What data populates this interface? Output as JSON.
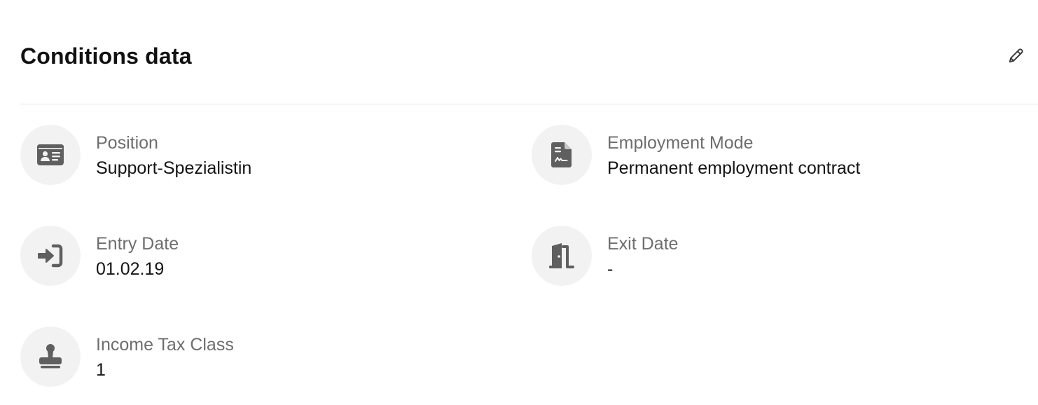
{
  "title": "Conditions data",
  "edit_icon": "pencil-icon",
  "fields": [
    {
      "label": "Position",
      "value": "Support-Spezialistin",
      "icon": "id-card-icon"
    },
    {
      "label": "Employment Mode",
      "value": "Permanent employment contract",
      "icon": "contract-file-icon"
    },
    {
      "label": "Entry Date",
      "value": "01.02.19",
      "icon": "sign-in-icon"
    },
    {
      "label": "Exit Date",
      "value": "-",
      "icon": "door-open-icon"
    },
    {
      "label": "Income Tax Class",
      "value": "1",
      "icon": "stamp-icon"
    }
  ],
  "colors": {
    "icon": "#5f5f5f",
    "icon_background": "#f2f2f2",
    "label": "#6e6e6e",
    "value": "#141414",
    "divider": "#e3e3e3"
  }
}
